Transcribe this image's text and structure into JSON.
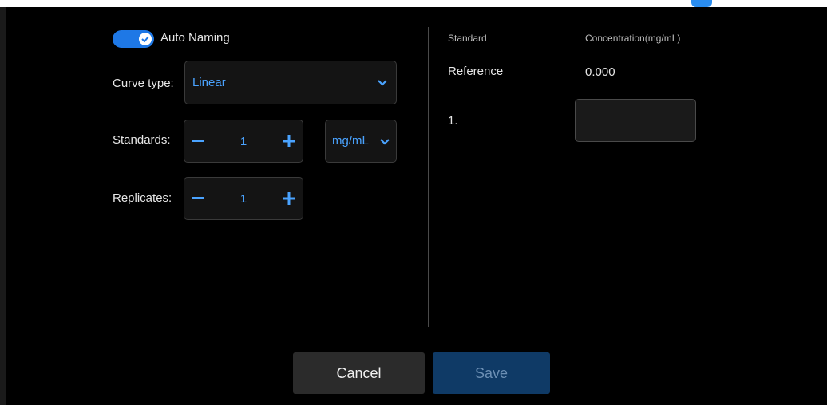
{
  "auto_naming": {
    "label": "Auto Naming",
    "enabled": true
  },
  "curve_type": {
    "label": "Curve type:",
    "value": "Linear"
  },
  "standards": {
    "label": "Standards:",
    "value": "1",
    "unit": "mg/mL"
  },
  "replicates": {
    "label": "Replicates:",
    "value": "1"
  },
  "table": {
    "headers": {
      "standard": "Standard",
      "concentration": "Concentration(mg/mL)"
    },
    "reference": {
      "name": "Reference",
      "value": "0.000"
    },
    "rows": [
      {
        "name": "1.",
        "value": ""
      }
    ]
  },
  "buttons": {
    "cancel": "Cancel",
    "save": "Save"
  },
  "colors": {
    "accent": "#1e78e6",
    "link": "#4aa3ff",
    "save_bg": "#0f3a66",
    "cancel_bg": "#2b2b2b"
  },
  "icons": {
    "toggle": "check-icon",
    "dropdown": "chevron-down-icon",
    "decrement": "minus-icon",
    "increment": "plus-icon"
  }
}
